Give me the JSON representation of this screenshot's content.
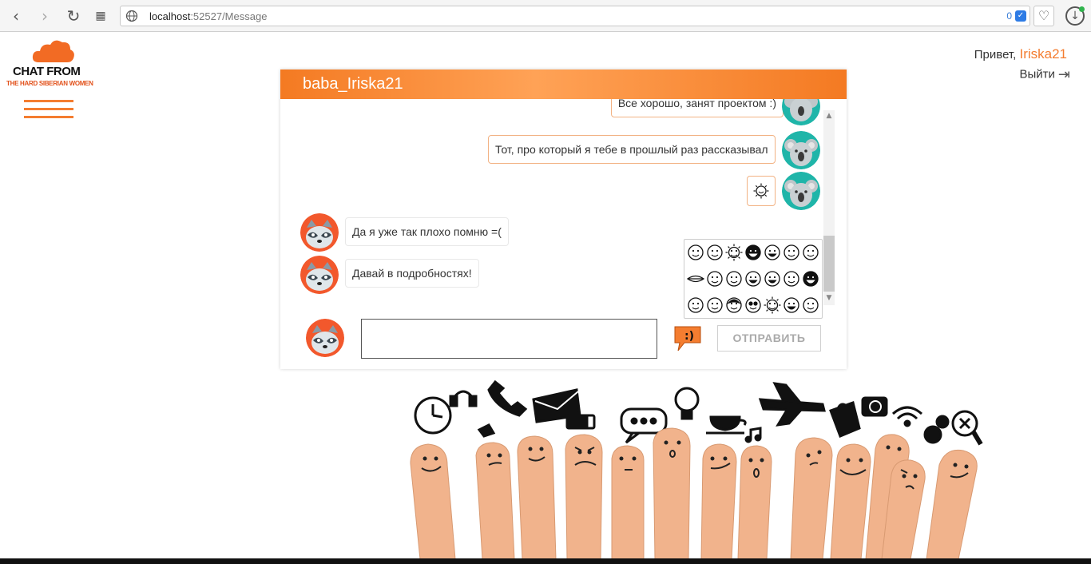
{
  "browser": {
    "url_host": "localhost",
    "url_path": ":52527/Message",
    "badge_count": "0"
  },
  "header": {
    "logo_line1": "CHAT FROM",
    "logo_line2": "THE HARD SIBERIAN WOMEN",
    "greeting": "Привет,",
    "username": "Iriska21",
    "logout_label": "Выйти"
  },
  "chat": {
    "title": "baba_Iriska21",
    "messages": [
      {
        "text": "Все хорошо, занят проектом :)",
        "side": "right"
      },
      {
        "text": "Тот, про который я тебе в прошлый раз рассказывал",
        "side": "right"
      },
      {
        "text": "",
        "side": "right",
        "emoji": "sun-smile-emoji"
      },
      {
        "text": "Да я уже так плохо помню =(",
        "side": "left"
      },
      {
        "text": "Давай в подробностях!",
        "side": "left"
      }
    ],
    "send_label": "ОТПРАВИТЬ",
    "input_value": ""
  },
  "emoji_panel": {
    "rows": [
      [
        "smile",
        "smile",
        "sun-smile",
        "grin-dark",
        "grin",
        "squint",
        "smile"
      ],
      [
        "lips",
        "wink",
        "smile",
        "grin",
        "laugh",
        "smile",
        "grin-dark"
      ],
      [
        "smile",
        "smile",
        "hair",
        "cool",
        "sun",
        "happy",
        "smile"
      ]
    ]
  },
  "colors": {
    "accent": "#f47d30",
    "header_gradient_light": "#ffa256"
  }
}
